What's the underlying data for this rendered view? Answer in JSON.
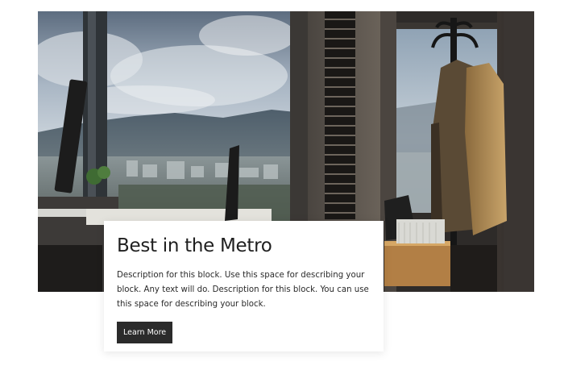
{
  "hero": {
    "image_alt": "Office interior with city and mountain view through large windows, coat rack with jackets"
  },
  "card": {
    "title": "Best in the Metro",
    "description": "Description for this block. Use this space for describing your block. Any text will do. Description for this block. You can use this space for describing your block.",
    "button_label": "Learn More"
  },
  "colors": {
    "button_bg": "#2b2b2b",
    "button_text": "#ffffff",
    "title_text": "#1f1f1f",
    "body_text": "#2a2a2a",
    "card_bg": "#ffffff"
  }
}
